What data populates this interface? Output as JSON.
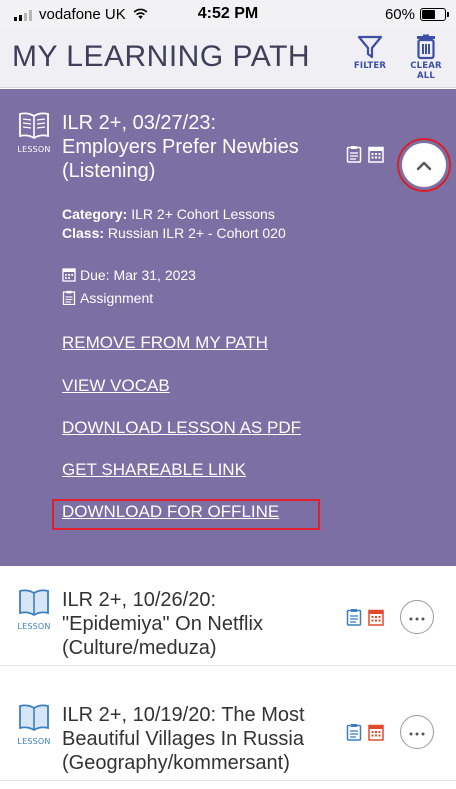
{
  "status_bar": {
    "carrier": "vodafone UK",
    "time": "4:52 PM",
    "battery": "60%",
    "battery_level": 0.6
  },
  "header": {
    "title": "MY LEARNING PATH",
    "filter_label": "FILTER",
    "clear_label": "CLEAR ALL",
    "accent": "#3d4fa6"
  },
  "expanded_item": {
    "icon_label": "LESSON",
    "title_line1": "ILR 2+, 03/27/23:",
    "title_line2": "Employers Prefer Newbies",
    "title_line3": "(Listening)",
    "category_label": "Category:",
    "category_value": "ILR 2+ Cohort Lessons",
    "class_label": "Class:",
    "class_value": "Russian ILR 2+ - Cohort 020",
    "due": "Due: Mar 31, 2023",
    "assignment": "Assignment",
    "actions": [
      "REMOVE FROM MY PATH",
      "VIEW VOCAB",
      "DOWNLOAD LESSON AS PDF",
      "GET SHAREABLE LINK",
      "DOWNLOAD FOR OFFLINE"
    ],
    "background": "#7b6fa3"
  },
  "list_items": [
    {
      "icon_label": "LESSON",
      "line1": "ILR 2+, 10/26/20:",
      "line2": "\"Epidemiya\" On Netflix",
      "line3": "(Culture/meduza)"
    },
    {
      "icon_label": "LESSON",
      "line1": "ILR 2+, 10/19/20: The Most",
      "line2": "Beautiful Villages In Russia",
      "line3": "(Geography/kommersant)"
    }
  ],
  "icons": {
    "clipboard": "clipboard-icon",
    "calendar": "calendar-icon",
    "book": "book-icon",
    "more": "more-icon"
  }
}
